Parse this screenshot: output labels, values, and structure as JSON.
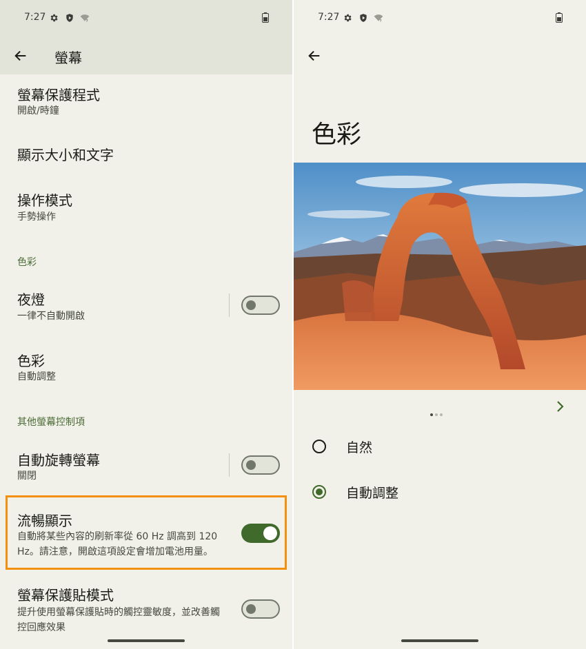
{
  "status_bar": {
    "time": "7:27"
  },
  "left_screen": {
    "title": "螢幕",
    "items": [
      {
        "title": "螢幕保護程式",
        "summary": "開啟/時鐘"
      },
      {
        "title": "顯示大小和文字"
      },
      {
        "title": "操作模式",
        "summary": "手勢操作"
      },
      {
        "title": "夜燈",
        "summary": "一律不自動開啟",
        "toggle": false
      },
      {
        "title": "色彩",
        "summary": "自動調整"
      },
      {
        "title": "自動旋轉螢幕",
        "summary": "關閉",
        "toggle": false
      },
      {
        "title": "流暢顯示",
        "summary_line1": "自動將某些內容的刷新率從 60 Hz 調高到 120",
        "summary_line2": "Hz。請注意，開啟這項設定會增加電池用量。",
        "toggle": true
      },
      {
        "title": "螢幕保護貼模式",
        "summary_line1": "提升使用螢幕保護貼時的觸控靈敏度，並改善觸",
        "summary_line2": "控回應效果",
        "toggle": false
      }
    ],
    "sections": {
      "color": "色彩",
      "other": "其他螢幕控制項"
    }
  },
  "right_screen": {
    "title": "色彩",
    "carousel": {
      "pages": 3,
      "current": 1
    },
    "options": [
      {
        "label": "自然",
        "selected": false
      },
      {
        "label": "自動調整",
        "selected": true
      }
    ]
  },
  "colors": {
    "accent": "#3f6a2c",
    "section_text": "#4c6b36",
    "highlight_border": "#f39010",
    "background": "#f1f1e9",
    "app_bar": "#e2e3d9"
  }
}
